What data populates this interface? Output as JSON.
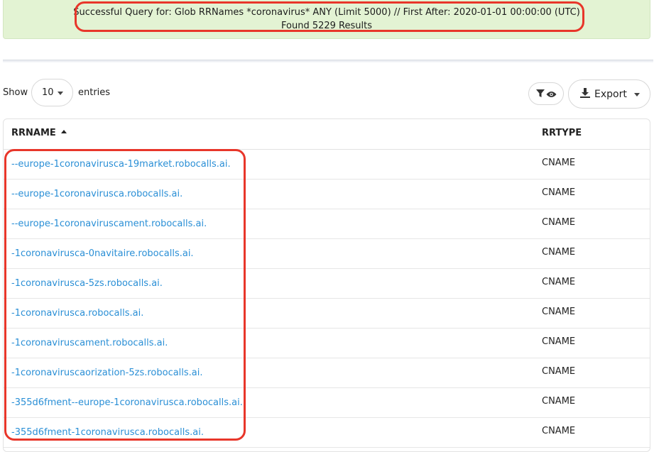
{
  "banner": {
    "line1": "Successful Query for: Glob RRNames *coronavirus* ANY (Limit 5000) // First After: 2020-01-01 00:00:00 (UTC)",
    "line2": "Found 5229 Results"
  },
  "controls": {
    "show_label": "Show",
    "page_length": "10",
    "entries_label": "entries",
    "export_label": "Export"
  },
  "icons": {
    "filter": "filter-icon",
    "eye": "eye-icon",
    "download": "download-icon"
  },
  "table": {
    "columns": [
      "RRNAME",
      "RRTYPE"
    ],
    "sort": {
      "column": "RRNAME",
      "direction": "ascending"
    },
    "rows": [
      {
        "rrname": "--europe-1coronavirusca-19market.robocalls.ai.",
        "rrtype": "CNAME"
      },
      {
        "rrname": "--europe-1coronavirusca.robocalls.ai.",
        "rrtype": "CNAME"
      },
      {
        "rrname": "--europe-1coronaviruscament.robocalls.ai.",
        "rrtype": "CNAME"
      },
      {
        "rrname": "-1coronavirusca-0navitaire.robocalls.ai.",
        "rrtype": "CNAME"
      },
      {
        "rrname": "-1coronavirusca-5zs.robocalls.ai.",
        "rrtype": "CNAME"
      },
      {
        "rrname": "-1coronavirusca.robocalls.ai.",
        "rrtype": "CNAME"
      },
      {
        "rrname": "-1coronaviruscament.robocalls.ai.",
        "rrtype": "CNAME"
      },
      {
        "rrname": "-1coronaviruscaorization-5zs.robocalls.ai.",
        "rrtype": "CNAME"
      },
      {
        "rrname": "-355d6fment--europe-1coronavirusca.robocalls.ai.",
        "rrtype": "CNAME"
      },
      {
        "rrname": "-355d6fment-1coronavirusca.robocalls.ai.",
        "rrtype": "CNAME"
      }
    ]
  },
  "colors": {
    "banner_bg": "#e3f3d3",
    "link": "#2a8fd6",
    "highlight": "#e8362a"
  }
}
